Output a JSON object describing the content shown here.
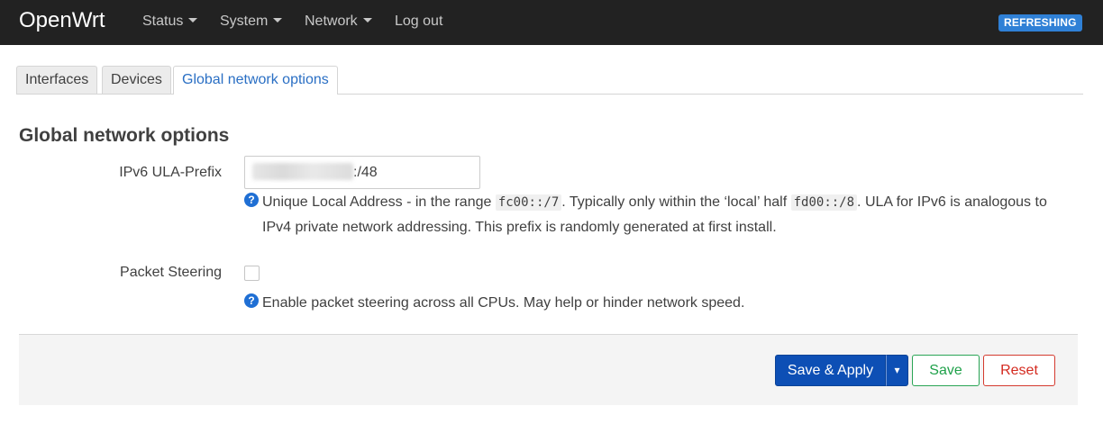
{
  "navbar": {
    "brand": "OpenWrt",
    "menu": [
      {
        "label": "Status",
        "has_dropdown": true
      },
      {
        "label": "System",
        "has_dropdown": true
      },
      {
        "label": "Network",
        "has_dropdown": true
      },
      {
        "label": "Log out",
        "has_dropdown": false
      }
    ],
    "status_badge": "REFRESHING"
  },
  "tabs": [
    {
      "label": "Interfaces",
      "active": false
    },
    {
      "label": "Devices",
      "active": false
    },
    {
      "label": "Global network options",
      "active": true
    }
  ],
  "section": {
    "title": "Global network options",
    "ula": {
      "label": "IPv6 ULA-Prefix",
      "value_visible_suffix": ":/48",
      "help_parts": {
        "p1": "Unique Local Address - in the range ",
        "code1": "fc00::/7",
        "p2": ". Typically only within the ‘local’ half ",
        "code2": "fd00::/8",
        "p3": ". ULA for IPv6 is analogous to",
        "line2": "IPv4 private network addressing. This prefix is randomly generated at first install."
      }
    },
    "steering": {
      "label": "Packet Steering",
      "checked": false,
      "help": "Enable packet steering across all CPUs. May help or hinder network speed."
    }
  },
  "actions": {
    "save_apply": "Save & Apply",
    "dropdown_glyph": "▾",
    "save": "Save",
    "reset": "Reset"
  },
  "icons": {
    "help": "?"
  },
  "colors": {
    "navbar_bg": "#222222",
    "accent_blue": "#0d4fb5",
    "badge_blue": "#2f80d6",
    "save_green": "#1fa14a",
    "reset_red": "#d42a1f"
  }
}
